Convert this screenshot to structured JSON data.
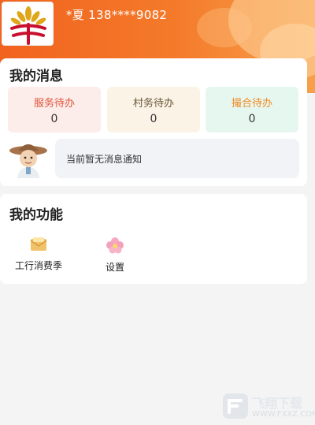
{
  "header": {
    "username": "*夏 138****9082"
  },
  "messages": {
    "title": "我的消息",
    "todos": [
      {
        "label": "服务待办",
        "count": "0",
        "label_color": "#e0553a",
        "bg": "#fcecea"
      },
      {
        "label": "村务待办",
        "count": "0",
        "label_color": "#6b5a3a",
        "bg": "#fbf3e6"
      },
      {
        "label": "撮合待办",
        "count": "0",
        "label_color": "#f08a22",
        "bg": "#e6f7ef"
      }
    ],
    "notice": "当前暂无消息通知"
  },
  "functions": {
    "title": "我的功能",
    "items": [
      {
        "label": "工行消费季",
        "icon": "envelope-icon"
      },
      {
        "label": "设置",
        "icon": "flower-icon"
      }
    ]
  },
  "watermark": {
    "text": "飞翔下载",
    "url": "WWW.FXXZ.COM"
  }
}
